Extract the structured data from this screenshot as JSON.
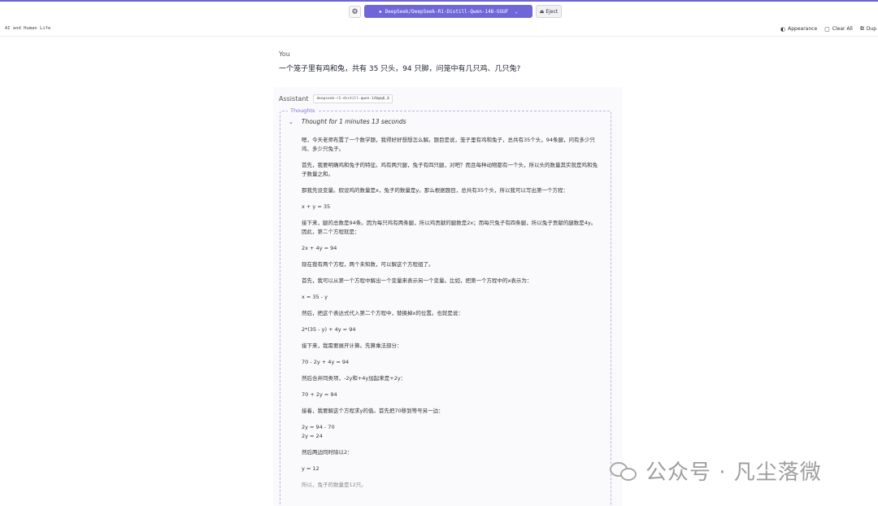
{
  "topbar": {
    "settings_icon": "gear-icon",
    "model_selector": "DeepSeek/DeepSeek-R1-Distill-Qwen-14B-GGUF",
    "eject_label": "Eject"
  },
  "subbar": {
    "chat_title": "AI and Human Life",
    "actions": [
      {
        "label": "Appearance",
        "icon": "palette-icon"
      },
      {
        "label": "Clear All",
        "icon": "clear-icon"
      },
      {
        "label": "Dup",
        "icon": "duplicate-icon"
      }
    ]
  },
  "user_message": {
    "role": "You",
    "text": "一个笼子里有鸡和兔，共有 35 只头，94 只脚，问笼中有几只鸡、几只兔?"
  },
  "assistant_message": {
    "role": "Assistant",
    "model_tag": "deepseek-r1-distill-qwen-14b@q6_0",
    "thoughts_label": "Thoughts",
    "thought_toggle": "Thought for 1 minutes 13 seconds",
    "paragraphs": [
      "嗯，今天老师布置了一个数学题，我得好好想想怎么解。题目是说，笼子里有鸡和兔子，总共有35个头，94条腿，问有多少只鸡、多少只兔子。",
      "首先，我要明确鸡和兔子的特征。鸡有两只腿，兔子有四只腿，对吧？而且每种动物都有一个头，所以头的数量其实就是鸡和兔子数量之和。",
      "那我先设变量。假设鸡的数量是x，兔子的数量是y。那么根据题目，总共有35个头，所以我可以写出第一个方程：",
      "x + y = 35",
      "接下来，腿的总数是94条。因为每只鸡有两条腿，所以鸡贡献的腿数是2x；而每只兔子有四条腿，所以兔子贡献的腿数是4y。因此，第二个方程就是：",
      "2x + 4y = 94",
      "现在我有两个方程，两个未知数，可以解这个方程组了。",
      "首先，我可以从第一个方程中解出一个变量来表示另一个变量。比如，把第一个方程中的x表示为：",
      "x = 35 - y",
      "然后，把这个表达式代入第二个方程中，替换掉x的位置。也就是说：",
      "2*(35 - y) + 4y = 94",
      "接下来，我需要展开计算。先算乘法部分：",
      "70 - 2y + 4y = 94",
      "然后合并同类项，-2y和+4y加起来是+2y：",
      "70 + 2y = 94",
      "接着，我要解这个方程求y的值。首先把70移到等号另一边：",
      "2y = 94 - 70\n2y = 24",
      "然后两边同时除以2：",
      "y = 12",
      "所以，兔子的数量是12只。"
    ]
  },
  "watermark": {
    "text": "公众号 · 凡尘落微",
    "icon": "wechat-logo-icon"
  }
}
